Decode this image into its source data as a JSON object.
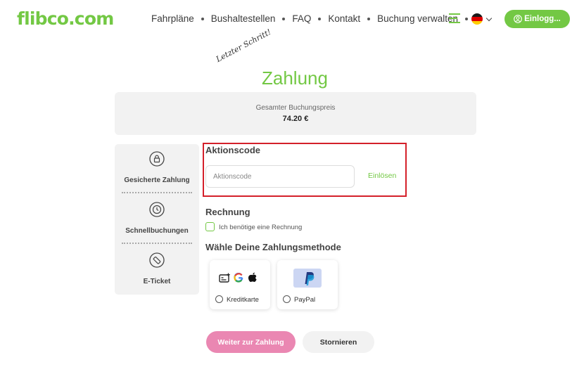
{
  "header": {
    "logo": "flibco.com",
    "nav": [
      "Fahrpläne",
      "Bushaltestellen",
      "FAQ",
      "Kontakt",
      "Buchung verwalten"
    ],
    "login_label": "Einlogg..."
  },
  "colors": {
    "brand_green": "#73c844",
    "primary_pink": "#ea87b2",
    "highlight_red": "#d4202a"
  },
  "page": {
    "tagline": "Letzter Schritt!",
    "title": "Zahlung"
  },
  "summary": {
    "label": "Gesamter Buchungspreis",
    "price": "74.20 €"
  },
  "sidebar": {
    "items": [
      {
        "label": "Gesicherte Zahlung",
        "icon": "lock-icon"
      },
      {
        "label": "Schnellbuchungen",
        "icon": "clock-icon"
      },
      {
        "label": "E-Ticket",
        "icon": "ticket-icon"
      }
    ]
  },
  "promo": {
    "title": "Aktionscode",
    "placeholder": "Aktionscode",
    "redeem": "Einlösen"
  },
  "invoice": {
    "title": "Rechnung",
    "checkbox_label": "Ich benötige eine Rechnung"
  },
  "payment": {
    "title": "Wähle Deine Zahlungsmethode",
    "methods": [
      {
        "label": "Kreditkarte",
        "icons": [
          "credit-card-icon",
          "google-icon",
          "apple-icon"
        ]
      },
      {
        "label": "PayPal",
        "icons": [
          "paypal-icon"
        ]
      }
    ]
  },
  "actions": {
    "continue": "Weiter zur Zahlung",
    "cancel": "Stornieren"
  }
}
